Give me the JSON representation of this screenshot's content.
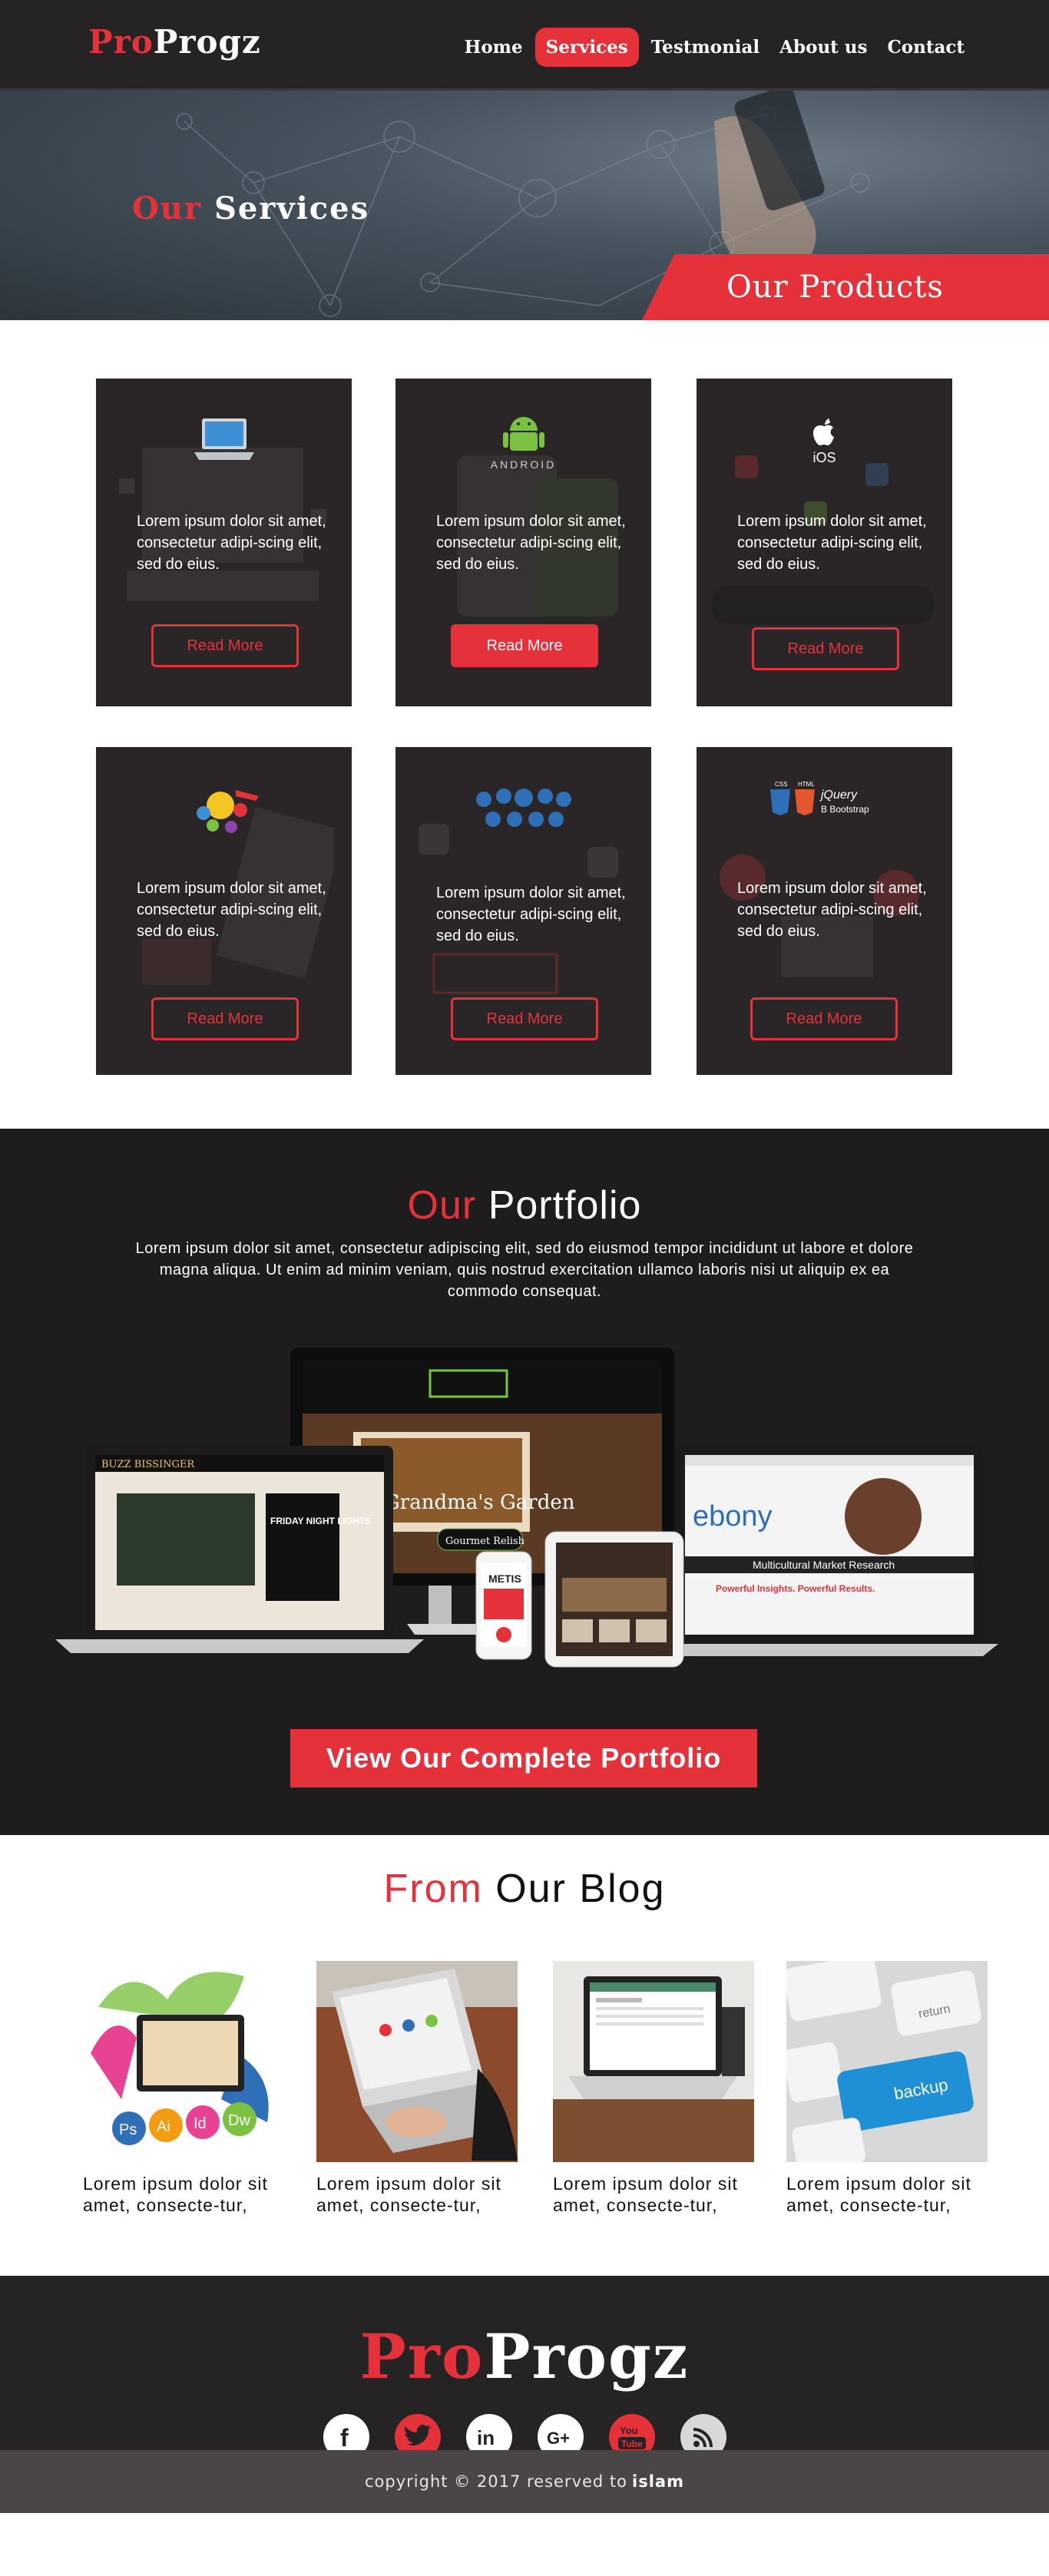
{
  "brand": {
    "pro": "Pro",
    "progz": "Progz",
    "accent_color": "#e5323a",
    "dark_color": "#262324"
  },
  "nav": {
    "items": [
      {
        "label": "Home",
        "active": false
      },
      {
        "label": "Services",
        "active": true
      },
      {
        "label": "Testmonial",
        "active": false
      },
      {
        "label": "About us",
        "active": false
      },
      {
        "label": "Contact",
        "active": false
      }
    ]
  },
  "hero": {
    "title_accent": "Our",
    "title_rest": "Services",
    "banner": "Our Products"
  },
  "services": {
    "cards": [
      {
        "icon": "laptop-icon",
        "text": "Lorem ipsum dolor sit amet, consectetur adipi-scing elit, sed do eius.",
        "button": "Read More",
        "filled": false
      },
      {
        "icon": "android-icon",
        "icon_label": "ANDROID",
        "text": "Lorem ipsum dolor sit amet, consectetur adipi-scing elit, sed do eius.",
        "button": "Read More",
        "filled": true
      },
      {
        "icon": "apple-ios-icon",
        "icon_label": "iOS",
        "text": "Lorem ipsum dolor sit amet, consectetur adipi-scing elit, sed do eius.",
        "button": "Read More",
        "filled": false
      },
      {
        "icon": "seo-social-icon",
        "text": "Lorem ipsum dolor sit amet, consectetur adipi-scing elit, sed do eius.",
        "button": "Read More",
        "filled": false
      },
      {
        "icon": "cloud-apps-icon",
        "text": "Lorem ipsum dolor sit amet, consectetur adipi-scing elit, sed do eius.",
        "button": "Read More",
        "filled": false
      },
      {
        "icon": "html-css-jquery-icon",
        "icon_label_css": "CSS",
        "icon_label_html": "HTML",
        "icon_label_jquery": "jQuery",
        "icon_label_bootstrap": "B Bootstrap",
        "text": "Lorem ipsum dolor sit amet, consectetur adipi-scing elit, sed do eius.",
        "button": "Read More",
        "filled": false
      }
    ]
  },
  "portfolio": {
    "title_accent": "Our",
    "title_rest": "Portfolio",
    "lead": "Lorem ipsum dolor sit amet, consectetur adipiscing elit, sed do eiusmod tempor incididunt ut labore et dolore magna aliqua. Ut enim ad minim veniam, quis nostrud exercitation ullamco laboris nisi ut aliquip ex ea commodo consequat.",
    "button": "View Our Complete Portfolio",
    "mockups": {
      "laptop_title": "BUZZ BISSINGER",
      "laptop_poster": "FRIDAY NIGHT LIGHTS",
      "monitor_site": "Grandma's Garden",
      "monitor_badge": "Gourmet Relish",
      "right_laptop_brand": "ebony",
      "right_laptop_caption": "Multicultural Market Research",
      "right_laptop_tagline": "Powerful Insights. Powerful Results.",
      "phone_brand": "METIS"
    }
  },
  "blog": {
    "title_accent": "From",
    "title_rest": "Our Blog",
    "posts": [
      {
        "thumb": "adobe-suite-icon",
        "text": "Lorem ipsum dolor sit amet, consecte-tur,"
      },
      {
        "thumb": "laptop-typing-icon",
        "text": "Lorem ipsum dolor sit amet, consecte-tur,"
      },
      {
        "thumb": "laptop-desk-icon",
        "text": "Lorem ipsum dolor sit amet, consecte-tur,"
      },
      {
        "thumb": "keyboard-backup-icon",
        "text": "Lorem ipsum dolor sit amet, consecte-tur,"
      }
    ],
    "backup_key_label": "backup",
    "return_key_label": "return"
  },
  "footer": {
    "socials": [
      {
        "icon": "facebook-icon",
        "glyph": "f",
        "style": "white"
      },
      {
        "icon": "twitter-icon",
        "glyph": "t",
        "style": "red"
      },
      {
        "icon": "linkedin-icon",
        "glyph": "in",
        "style": "white"
      },
      {
        "icon": "google-plus-icon",
        "glyph": "G+",
        "style": "white"
      },
      {
        "icon": "youtube-icon",
        "glyph": "You Tube",
        "style": "red"
      },
      {
        "icon": "rss-icon",
        "glyph": "rss",
        "style": "grey"
      }
    ],
    "copyright_prefix": "copyright © 2017 reserved to",
    "copyright_name": "islam"
  }
}
